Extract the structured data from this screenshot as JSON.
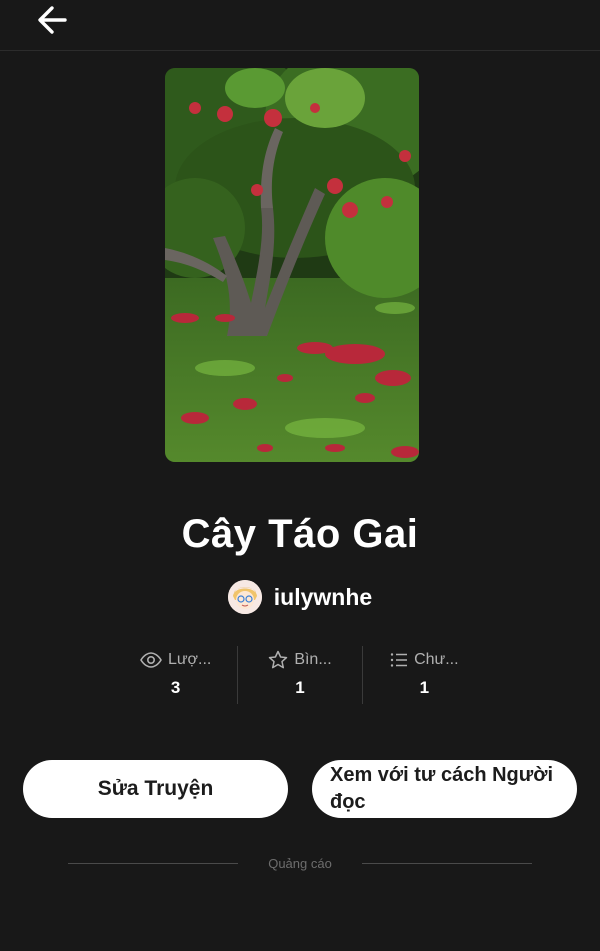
{
  "header": {
    "back_icon": "arrow-left-icon"
  },
  "story": {
    "title": "Cây Táo Gai",
    "cover_alt": "apple tree with fallen apples"
  },
  "author": {
    "name": "iulywnhe",
    "avatar_icon": "cartoon-avatar"
  },
  "stats": [
    {
      "icon": "eye-icon",
      "label": "Lượ...",
      "value": "3"
    },
    {
      "icon": "star-icon",
      "label": "Bìn...",
      "value": "1"
    },
    {
      "icon": "list-icon",
      "label": "Chư...",
      "value": "1"
    }
  ],
  "actions": {
    "edit_label": "Sửa Truyện",
    "view_as_reader_label": "Xem với tư cách Người đọc"
  },
  "ad": {
    "label": "Quảng cáo"
  },
  "colors": {
    "background": "#181818",
    "button": "#ffffff",
    "text": "#ffffff"
  }
}
